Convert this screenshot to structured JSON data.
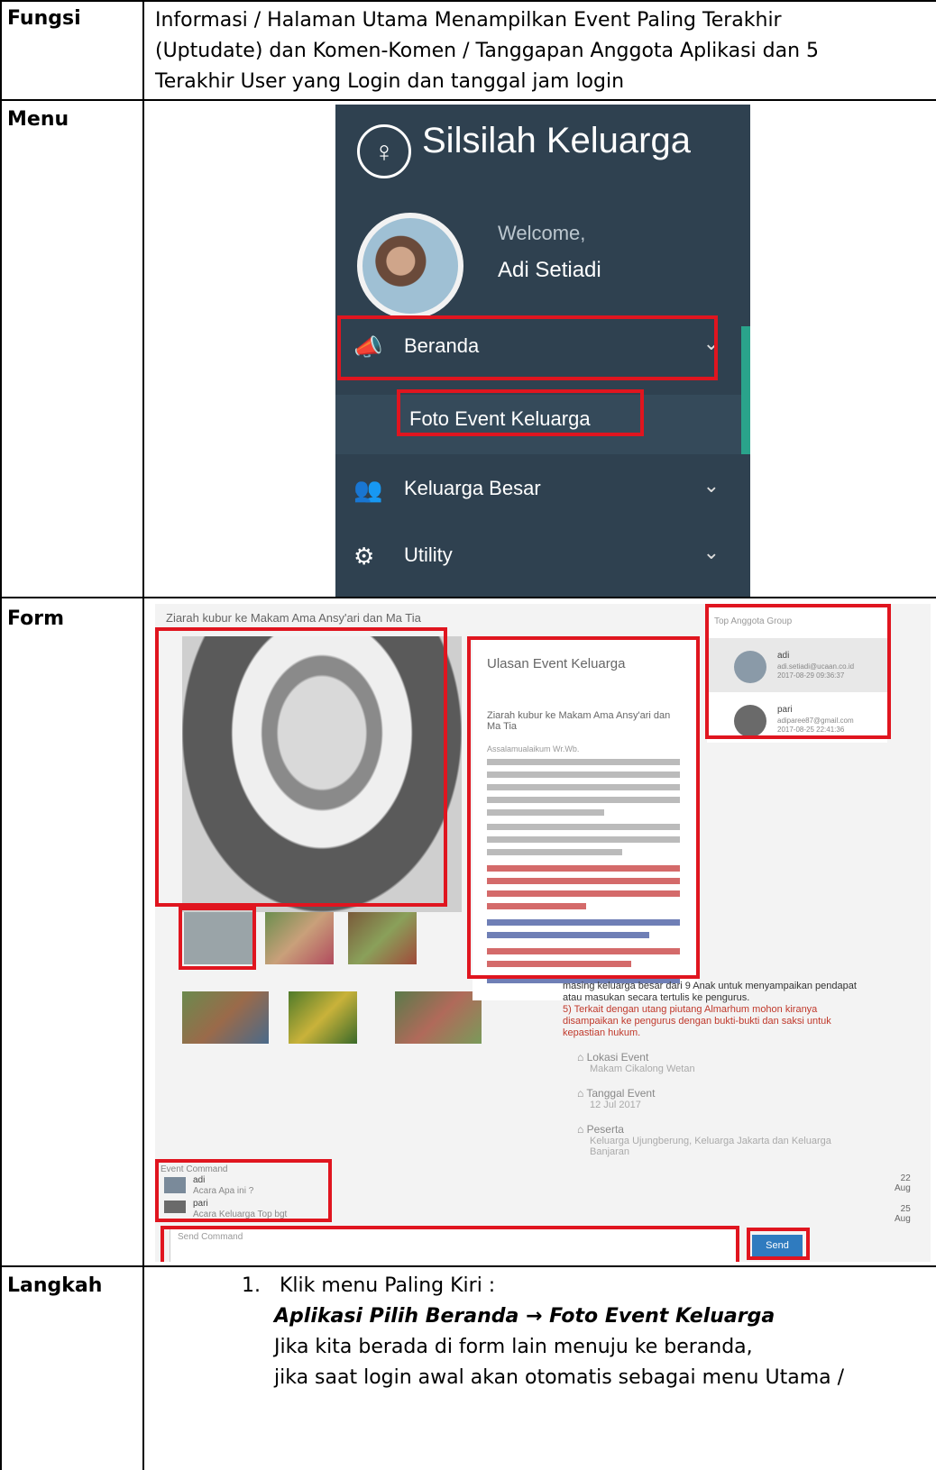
{
  "labels": {
    "fungsi": "Fungsi",
    "menu": "Menu",
    "form": "Form",
    "langkah": "Langkah"
  },
  "fungsi_lines": [
    "Informasi / Halaman Utama Menampilkan Event  Paling Terakhir",
    "(Uptudate) dan Komen-Komen / Tanggapan Anggota Aplikasi dan 5",
    "Terakhir User yang Login dan tanggal jam login"
  ],
  "menu": {
    "app_title": "Silsilah Keluarga",
    "welcome": "Welcome,",
    "user_name": "Adi Setiadi",
    "items": [
      {
        "label": "Beranda",
        "icon": "megaphone-icon"
      },
      {
        "label": "Foto Event Keluarga",
        "icon": ""
      },
      {
        "label": "Keluarga Besar",
        "icon": "users-icon"
      },
      {
        "label": "Utility",
        "icon": "gear-icon"
      }
    ]
  },
  "form": {
    "event_title": "Ziarah kubur ke Makam Ama Ansy'ari dan Ma Tia",
    "review_title": "Ulasan Event Keluarga",
    "review_event_name": "Ziarah kubur ke Makam Ama Ansy'ari dan Ma Tia",
    "review_greeting": "Assalamualaikum Wr.Wb.",
    "review_continuation": "masing keluarga besar dari 9 Anak untuk menyampaikan pendapat atau masukan secara tertulis ke pengurus.",
    "review_point5": "5) Terkait dengan utang piutang Almarhum mohon kiranya disampaikan ke pengurus dengan bukti-bukti dan saksi untuk kepastian hukum.",
    "lokasi_label": "Lokasi Event",
    "lokasi_value": "Makam Cikalong Wetan",
    "tanggal_label": "Tanggal Event",
    "tanggal_value": "12 Jul 2017",
    "peserta_label": "Peserta",
    "peserta_value": "Keluarga Ujungberung, Keluarga Jakarta dan Keluarga Banjaran",
    "members_title": "Top Anggota Group",
    "members": [
      {
        "name": "adi",
        "email": "adi.setiadi@ucaan.co.id",
        "time": "2017-08-29 09:36:37"
      },
      {
        "name": "pari",
        "email": "adiparee87@gmail.com",
        "time": "2017-08-25 22:41:36"
      }
    ],
    "comment_header": "Event Command",
    "comments": [
      {
        "name": "adi",
        "text": "Acara Apa ini ?",
        "day": "22",
        "month": "Aug"
      },
      {
        "name": "pari",
        "text": "Acara Keluarga Top bgt",
        "day": "25",
        "month": "Aug"
      }
    ],
    "comment_placeholder": "Send Command",
    "send_label": "Send"
  },
  "steps": {
    "number": "1.",
    "line1": "Klik menu Paling Kiri :",
    "line2": "Aplikasi Pilih Beranda → Foto Event Keluarga",
    "line3": "Jika kita berada di form lain menuju ke beranda,",
    "line4": "jika saat login awal akan otomatis sebagai menu Utama /"
  },
  "colors": {
    "sidebar_bg": "#2f4150",
    "highlight_red": "#e0151f",
    "accent_green": "#2aa38b",
    "send_blue": "#2f7bbf"
  }
}
